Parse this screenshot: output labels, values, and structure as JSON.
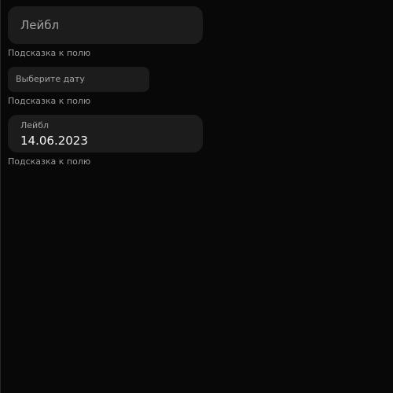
{
  "fields": [
    {
      "placeholder": "Лейбл",
      "hint": "Подсказка к полю"
    },
    {
      "placeholder": "Выберите дату",
      "hint": "Подсказка к полю"
    },
    {
      "label": "Лейбл",
      "value": "14.06.2023",
      "hint": "Подсказка к полю"
    }
  ]
}
